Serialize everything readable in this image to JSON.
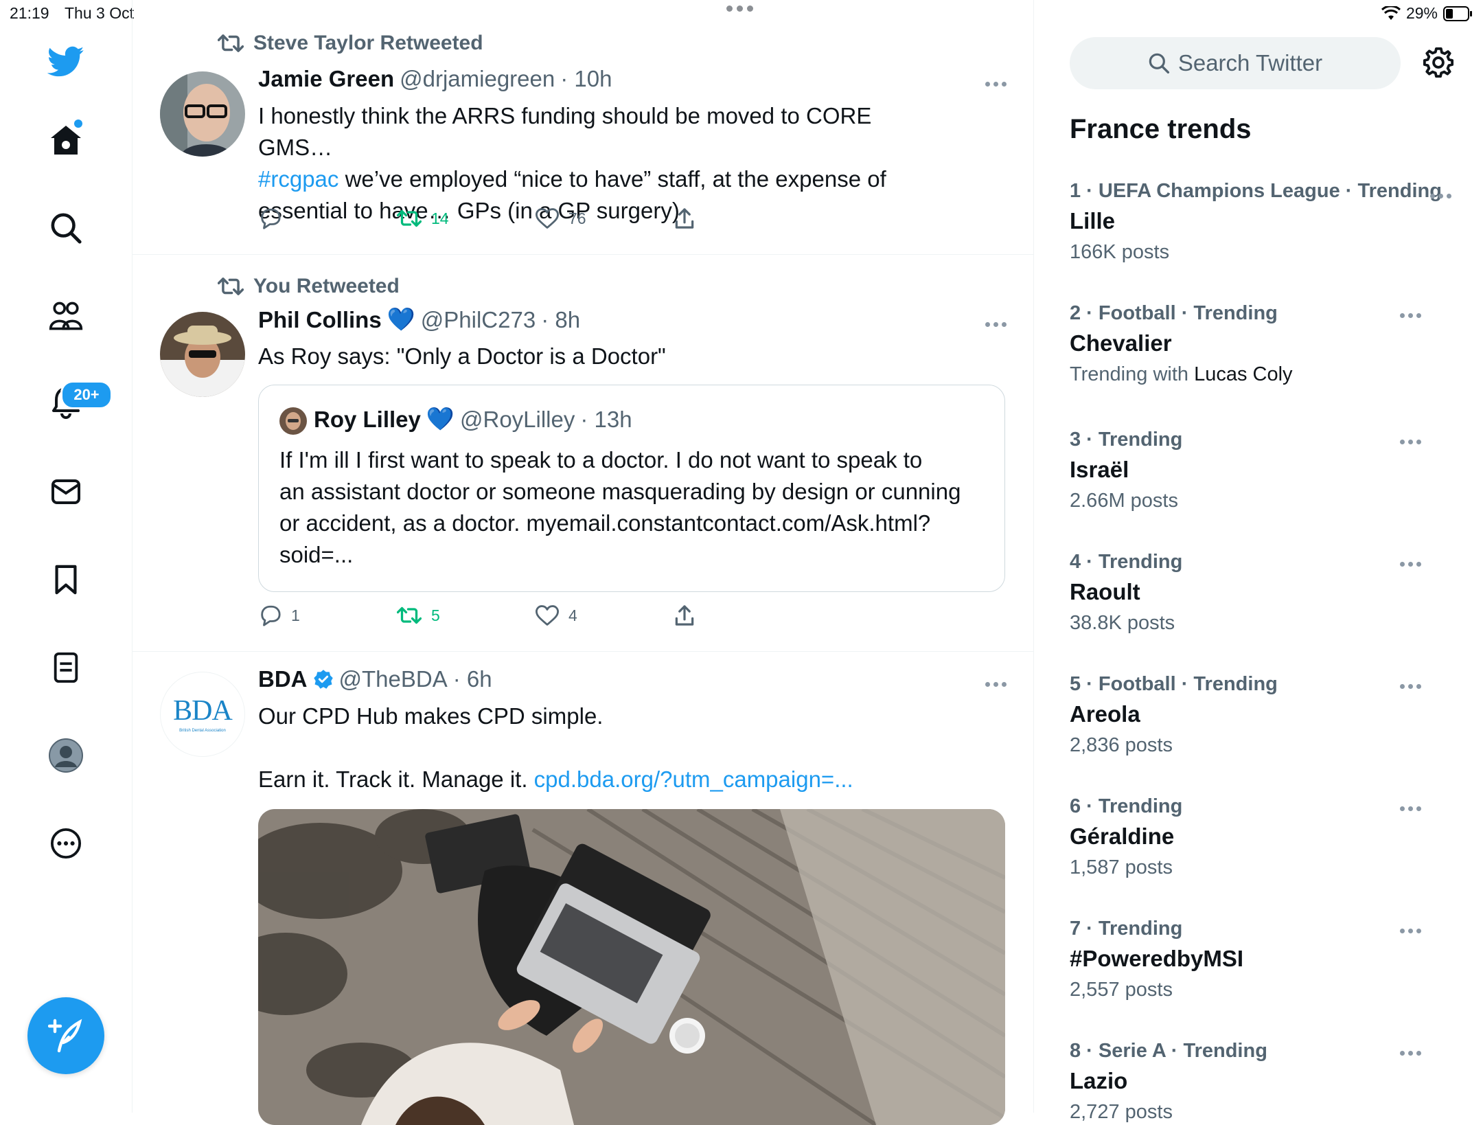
{
  "status_bar": {
    "time": "21:19",
    "date": "Thu 3 Oct",
    "battery": "29%"
  },
  "nav": {
    "notifications_badge": "20+",
    "items": [
      "twitter-logo-icon",
      "home-icon",
      "explore-icon",
      "communities-icon",
      "notifications-icon",
      "messages-icon",
      "bookmarks-icon",
      "lists-icon",
      "profile-icon",
      "more-icon"
    ]
  },
  "tweets": [
    {
      "retweet_label": "Steve Taylor Retweeted",
      "name": "Jamie Green",
      "handle": "@drjamiegreen",
      "time": "· 10h",
      "text_line1": "I honestly think the ARRS funding should be moved to CORE GMS…",
      "hashtag": "#rcgpac",
      "text_line2_rest": " we’ve employed “nice to have” staff, at the expense of",
      "text_line3": "essential to have… GPs (in a GP surgery)",
      "replies": "",
      "retweets": "14",
      "likes": "76"
    },
    {
      "retweet_label": "You Retweeted",
      "name": "Phil Collins",
      "verified_emoji": "💙",
      "handle": "@PhilC273",
      "time": "· 8h",
      "text": "As Roy says: \"Only a Doctor is a Doctor\"",
      "quote": {
        "name": "Roy Lilley",
        "verified_emoji": "💙",
        "handle": "@RoyLilley",
        "time": "· 13h",
        "line1": "If I'm ill I first want to speak to a doctor. I do not want to speak to",
        "line2": "an assistant doctor or someone masquerading by design or cunning",
        "line3": "or accident, as a doctor. myemail.constantcontact.com/Ask.html?",
        "line4": "soid=..."
      },
      "replies": "1",
      "retweets": "5",
      "likes": "4"
    },
    {
      "name": "BDA",
      "handle": "@TheBDA",
      "time": "· 6h",
      "avatar_text": "BDA",
      "avatar_subtext": "British Dental Association",
      "text_line1": "Our CPD Hub makes CPD simple.",
      "text_line2": "Earn it. Track it. Manage it. ",
      "link": "cpd.bda.org/?utm_campaign=..."
    }
  ],
  "search": {
    "placeholder": "Search Twitter"
  },
  "trends": {
    "title": "France trends",
    "items": [
      {
        "meta": "1 · UEFA Champions League · Trending",
        "name": "Lille",
        "count": "166K posts"
      },
      {
        "meta": "2 · Football · Trending",
        "name": "Chevalier",
        "count_prefix": "Trending with ",
        "count_strong": "Lucas Coly"
      },
      {
        "meta": "3 · Trending",
        "name": "Israël",
        "count": "2.66M posts"
      },
      {
        "meta": "4 · Trending",
        "name": "Raoult",
        "count": "38.8K posts"
      },
      {
        "meta": "5 · Football · Trending",
        "name": "Areola",
        "count": "2,836 posts"
      },
      {
        "meta": "6 · Trending",
        "name": "Géraldine",
        "count": "1,587 posts"
      },
      {
        "meta": "7 · Trending",
        "name": "#PoweredbyMSI",
        "count": "2,557 posts"
      },
      {
        "meta": "8 · Serie A · Trending",
        "name": "Lazio",
        "count": "2,727 posts"
      }
    ]
  },
  "colors": {
    "accent": "#1d9bf0",
    "retweet_green": "#00ba7c",
    "secondary_text": "#536471"
  }
}
